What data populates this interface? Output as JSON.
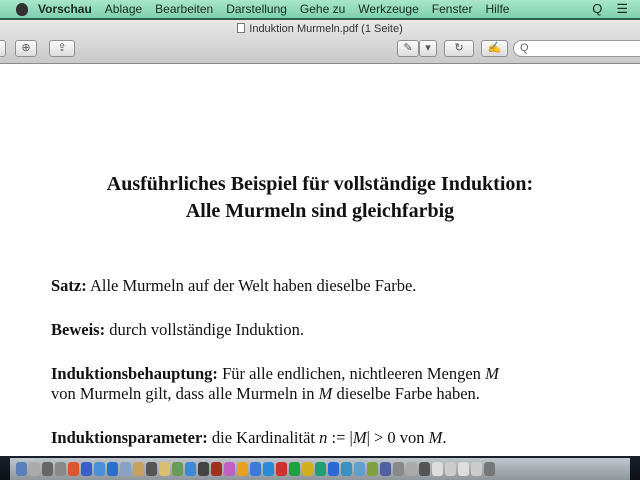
{
  "menubar": {
    "app": "Vorschau",
    "items": [
      "Ablage",
      "Bearbeiten",
      "Darstellung",
      "Gehe zu",
      "Werkzeuge",
      "Fenster",
      "Hilfe"
    ],
    "search_icon": "Q",
    "list_icon": "☰"
  },
  "window": {
    "title": "Induktion Murmeln.pdf (1 Seite)"
  },
  "toolbar": {
    "zoom_in": "⊕",
    "share": "⇪",
    "annotate": "✎",
    "annotate_menu": "▾",
    "rotate": "↻",
    "edit": "✍",
    "search_placeholder": "Q"
  },
  "document": {
    "title_line1": "Ausführliches Beispiel für vollständige Induktion:",
    "title_line2": "Alle Murmeln sind gleichfarbig",
    "satz_label": "Satz:",
    "satz_text": " Alle Murmeln auf der Welt haben dieselbe Farbe.",
    "beweis_label": "Beweis:",
    "beweis_text": " durch vollständige Induktion.",
    "ib_label": "Induktionsbehauptung:",
    "ib_text1": " Für alle endlichen, nichtleeren Mengen ",
    "ib_m1": "M",
    "ib_text2": "von Murmeln gilt, dass alle Murmeln in ",
    "ib_m2": "M",
    "ib_text3": " dieselbe Farbe haben.",
    "ip_label": "Induktionsparameter:",
    "ip_text1": " die Kardinalität ",
    "ip_n": "n",
    "ip_text2": " := |",
    "ip_m1": "M",
    "ip_text3": "| > 0 von ",
    "ip_m2": "M",
    "ip_text4": "."
  },
  "dock": {
    "colors": [
      "#5a7fb8",
      "#aaa",
      "#666",
      "#888",
      "#e0532f",
      "#3a5fc8",
      "#4a90d9",
      "#2a6fd0",
      "#8aa0c0",
      "#c8a060",
      "#555",
      "#d8c070",
      "#6a9a5a",
      "#3a8ad8",
      "#444",
      "#a03020",
      "#c060c0",
      "#e8a020",
      "#3a7ad8",
      "#2a8ad8",
      "#d03030",
      "#20a040",
      "#d0b020",
      "#20a070",
      "#2a6ad8",
      "#3a90c0",
      "#60a0d0",
      "#80a040",
      "#5060a0",
      "#888",
      "#aaa",
      "#555",
      "#ddd",
      "#ccc",
      "#ddd",
      "#ccc",
      "#777"
    ]
  }
}
